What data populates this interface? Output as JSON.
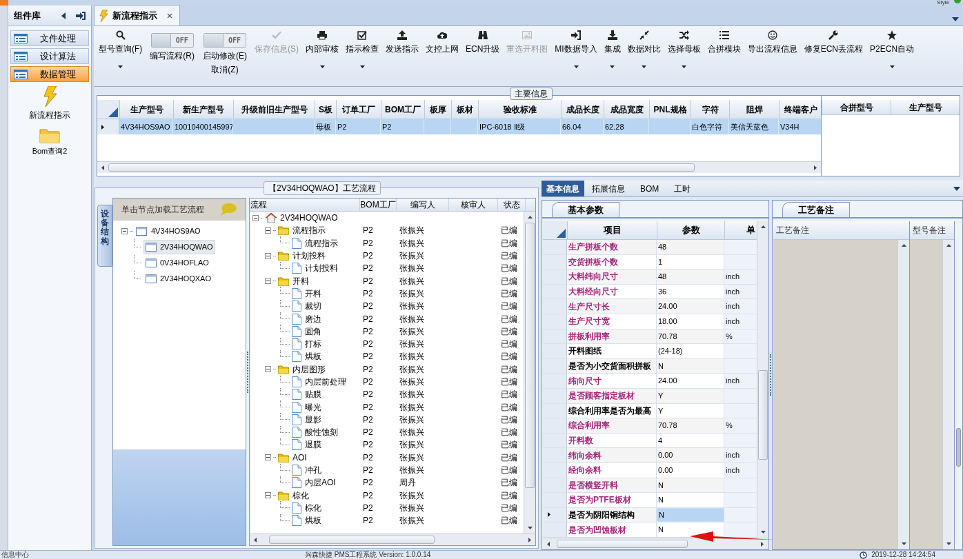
{
  "top_bar": {
    "style_menu": "Style"
  },
  "sidebar": {
    "title": "组件库",
    "items": [
      {
        "label": "文件处理",
        "selected": false
      },
      {
        "label": "设计算法",
        "selected": false
      },
      {
        "label": "数据管理",
        "selected": true
      }
    ],
    "shortcuts": [
      {
        "label": "新流程指示",
        "kind": "bolt"
      },
      {
        "label": "Bom查询2",
        "kind": "folder"
      }
    ]
  },
  "document_tabs": [
    {
      "label": "新流程指示",
      "selected": true,
      "closable": true
    }
  ],
  "toolbar": [
    {
      "kind": "button",
      "label": "型号查询(F)",
      "dropdown": true,
      "disabled": false
    },
    {
      "kind": "toggle",
      "label": "编写流程(R)",
      "switch_text": "OFF",
      "on": false
    },
    {
      "kind": "toggle",
      "label": "启动修改(E)\n取消(Z)",
      "switch_text": "OFF",
      "on": false
    },
    {
      "kind": "button",
      "label": "保存信息(S)",
      "dropdown": false,
      "disabled": true
    },
    {
      "kind": "button",
      "label": "内部审核",
      "dropdown": true,
      "disabled": false
    },
    {
      "kind": "button",
      "label": "指示检查",
      "dropdown": true,
      "disabled": false
    },
    {
      "kind": "button",
      "label": "发送指示",
      "dropdown": false,
      "disabled": false
    },
    {
      "kind": "button",
      "label": "文控上网",
      "dropdown": false,
      "disabled": false
    },
    {
      "kind": "button",
      "label": "ECN升级",
      "dropdown": false,
      "disabled": false
    },
    {
      "kind": "button",
      "label": "重选开料图",
      "dropdown": false,
      "disabled": true
    },
    {
      "kind": "button",
      "label": "MI数据导入",
      "dropdown": true,
      "disabled": false
    },
    {
      "kind": "button",
      "label": "集成",
      "dropdown": true,
      "disabled": false
    },
    {
      "kind": "button",
      "label": "数据对比",
      "dropdown": true,
      "disabled": false
    },
    {
      "kind": "button",
      "label": "选择母板",
      "dropdown": true,
      "disabled": false
    },
    {
      "kind": "button",
      "label": "合拼模块",
      "dropdown": false,
      "disabled": false
    },
    {
      "kind": "button",
      "label": "导出流程信息",
      "dropdown": false,
      "disabled": false
    },
    {
      "kind": "button",
      "label": "修复ECN丢流程",
      "dropdown": false,
      "disabled": false
    },
    {
      "kind": "button",
      "label": "P2ECN自动",
      "dropdown": true,
      "disabled": false
    }
  ],
  "main_info": {
    "title": "主要信息",
    "columns": [
      "生产型号",
      "新生产型号",
      "升级前旧生产型号",
      "S板",
      "订单工厂",
      "BOM工厂",
      "板厚",
      "板材",
      "验收标准",
      "成品长度",
      "成品宽度",
      "PNL规格",
      "字符",
      "阻焊",
      "终端客户"
    ],
    "rows": [
      {
        "selected": true,
        "cells": [
          "4V34HOS9AO",
          "10010400145997",
          null,
          "母板",
          "P2",
          "P2",
          null,
          null,
          "IPC-6018 Ⅱ级",
          "66.04",
          "62.28",
          null,
          "白色字符",
          "美信天蓝色",
          "V34H"
        ]
      }
    ],
    "side_columns": [
      "合拼型号",
      "生产型号"
    ]
  },
  "flow_panel": {
    "title": "【2V34HOQWAO】工艺流程",
    "side_tab": "设备结构",
    "hint": "单击节点加载工艺流程",
    "models": [
      {
        "label": "4V34HOS9AO",
        "selected": false,
        "expanded": true,
        "children": [
          {
            "label": "2V34HOQWAO",
            "selected": true
          },
          {
            "label": "0V34HOFLAO",
            "selected": false
          },
          {
            "label": "2V34HOQXAO",
            "selected": false
          }
        ]
      }
    ],
    "columns": [
      "流程",
      "BOM工厂",
      "编写人",
      "核审人",
      "状态"
    ],
    "steps": [
      {
        "kind": "home",
        "label": "2V34HOQWAO",
        "expanded": true,
        "children": [
          {
            "kind": "folder",
            "label": "流程指示",
            "bom": "P2",
            "writer": "张振兴",
            "status": "已编",
            "expanded": true,
            "children": [
              {
                "kind": "doc",
                "label": "流程指示",
                "bom": "P2",
                "writer": "张振兴",
                "status": "已编"
              }
            ]
          },
          {
            "kind": "folder",
            "label": "计划投料",
            "bom": "P2",
            "writer": "张振兴",
            "status": "已编",
            "expanded": true,
            "children": [
              {
                "kind": "doc",
                "label": "计划投料",
                "bom": "P2",
                "writer": "张振兴",
                "status": "已编"
              }
            ]
          },
          {
            "kind": "folder",
            "label": "开料",
            "bom": "P2",
            "writer": "张振兴",
            "status": "已编",
            "expanded": true,
            "children": [
              {
                "kind": "doc",
                "label": "开料",
                "bom": "P2",
                "writer": "张振兴",
                "status": "已编"
              },
              {
                "kind": "doc",
                "label": "裁切",
                "bom": "P2",
                "writer": "张振兴",
                "status": "已编"
              },
              {
                "kind": "doc",
                "label": "磨边",
                "bom": "P2",
                "writer": "张振兴",
                "status": "已编"
              },
              {
                "kind": "doc",
                "label": "圆角",
                "bom": "P2",
                "writer": "张振兴",
                "status": "已编"
              },
              {
                "kind": "doc",
                "label": "打标",
                "bom": "P2",
                "writer": "张振兴",
                "status": "已编"
              },
              {
                "kind": "doc",
                "label": "烘板",
                "bom": "P2",
                "writer": "张振兴",
                "status": "已编"
              }
            ]
          },
          {
            "kind": "folder",
            "label": "内层图形",
            "bom": "P2",
            "writer": "张振兴",
            "status": "已编",
            "expanded": true,
            "children": [
              {
                "kind": "doc",
                "label": "内层前处理",
                "bom": "P2",
                "writer": "张振兴",
                "status": "已编"
              },
              {
                "kind": "doc",
                "label": "贴膜",
                "bom": "P2",
                "writer": "张振兴",
                "status": "已编"
              },
              {
                "kind": "doc",
                "label": "曝光",
                "bom": "P2",
                "writer": "张振兴",
                "status": "已编"
              },
              {
                "kind": "doc",
                "label": "显影",
                "bom": "P2",
                "writer": "张振兴",
                "status": "已编"
              },
              {
                "kind": "doc",
                "label": "酸性蚀刻",
                "bom": "P2",
                "writer": "张振兴",
                "status": "已编"
              },
              {
                "kind": "doc",
                "label": "退膜",
                "bom": "P2",
                "writer": "张振兴",
                "status": "已编"
              }
            ]
          },
          {
            "kind": "folder",
            "label": "AOI",
            "bom": "P2",
            "writer": "张振兴",
            "status": "已编",
            "expanded": true,
            "children": [
              {
                "kind": "doc",
                "label": "冲孔",
                "bom": "P2",
                "writer": "张振兴",
                "status": "已编"
              },
              {
                "kind": "doc",
                "label": "内层AOI",
                "bom": "P2",
                "writer": "周丹",
                "status": "已编"
              }
            ]
          },
          {
            "kind": "folder",
            "label": "棕化",
            "bom": "P2",
            "writer": "张振兴",
            "status": "已编",
            "expanded": true,
            "children": [
              {
                "kind": "doc",
                "label": "棕化",
                "bom": "P2",
                "writer": "张振兴",
                "status": "已编"
              },
              {
                "kind": "doc",
                "label": "烘板",
                "bom": "P2",
                "writer": "张振兴",
                "status": "已编"
              }
            ]
          }
        ]
      }
    ]
  },
  "detail_panel": {
    "tabs": [
      {
        "label": "基本信息",
        "selected": true
      },
      {
        "label": "拓展信息",
        "selected": false
      },
      {
        "label": "BOM",
        "selected": false
      },
      {
        "label": "工时",
        "selected": false
      }
    ],
    "params": {
      "tab": "基本参数",
      "columns": [
        "项目",
        "参数",
        "单"
      ],
      "rows": [
        {
          "item": "生产拼板个数",
          "value": "48",
          "color": "#a8257d",
          "selected": false
        },
        {
          "item": "交货拼板个数",
          "value": "1",
          "color": "#a8257d",
          "selected": false
        },
        {
          "item": "大料纬向尺寸",
          "value": "48",
          "unit": "inch",
          "color": "#a8257d",
          "selected": false
        },
        {
          "item": "大料经向尺寸",
          "value": "36",
          "unit": "inch",
          "color": "#a8257d",
          "selected": false
        },
        {
          "item": "生产尺寸长",
          "value": "24.00",
          "unit": "inch",
          "color": "#a8257d",
          "selected": false
        },
        {
          "item": "生产尺寸宽",
          "value": "18.00",
          "unit": "inch",
          "color": "#a8257d",
          "selected": false
        },
        {
          "item": "拼板利用率",
          "value": "70.78",
          "unit": "%",
          "color": "#a8257d",
          "selected": false
        },
        {
          "item": "开料图纸",
          "value": "(24-18)",
          "color": "#000000",
          "selected": false
        },
        {
          "item": "是否为小交货面积拼板",
          "value": "N",
          "color": "#000000",
          "selected": false
        },
        {
          "item": "纬向尺寸",
          "value": "24.00",
          "unit": "inch",
          "color": "#a8257d",
          "selected": false
        },
        {
          "item": "是否顾客指定板材",
          "value": "Y",
          "color": "#a8257d",
          "selected": false
        },
        {
          "item": "综合利用率是否为最高",
          "value": "Y",
          "color": "#000000",
          "selected": false
        },
        {
          "item": "综合利用率",
          "value": "70.78",
          "unit": "%",
          "color": "#a8257d",
          "selected": false
        },
        {
          "item": "开料数",
          "value": "4",
          "color": "#a8257d",
          "selected": false
        },
        {
          "item": "纬向余料",
          "value": "0.00",
          "unit": "inch",
          "color": "#a8257d",
          "selected": false
        },
        {
          "item": "经向余料",
          "value": "0.00",
          "unit": "inch",
          "color": "#a8257d",
          "selected": false
        },
        {
          "item": "是否横竖开料",
          "value": "N",
          "color": "#a8257d",
          "selected": false
        },
        {
          "item": "是否为PTFE板材",
          "value": "N",
          "color": "#a8257d",
          "selected": false
        },
        {
          "item": "是否为阴阳铜结构",
          "value": "N",
          "color": "#000000",
          "selected": true
        },
        {
          "item": "是否为凹蚀板材",
          "value": "N",
          "color": "#a8257d",
          "selected": false
        }
      ]
    },
    "notes": {
      "tab": "工艺备注",
      "columns": [
        "工艺备注",
        "型号备注"
      ]
    }
  },
  "status_bar": {
    "left": "信息中心",
    "center": "兴森快捷 PMS工程系统 Version: 1.0.0.14",
    "time": "2019-12-28 14:24:54"
  }
}
